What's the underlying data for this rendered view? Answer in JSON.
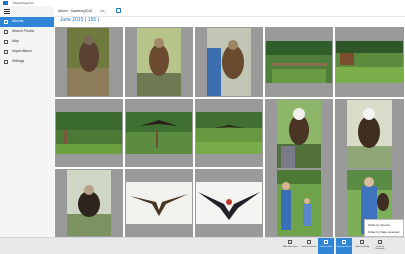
{
  "window": {
    "title": "PhotoOrganizer"
  },
  "sidebar": {
    "items": [
      {
        "label": "Albums",
        "active": true
      },
      {
        "label": "Search Photos",
        "active": false
      },
      {
        "label": "Map",
        "active": false
      },
      {
        "label": "Import Album",
        "active": false
      },
      {
        "label": "Settings",
        "active": false
      }
    ]
  },
  "topbar": {
    "title": "Album - Saarburg2015",
    "count": "(18 )"
  },
  "group": {
    "header": "June 2015 ( 155 )"
  },
  "toolbar": {
    "buttons": [
      {
        "label": "Slide Show Start",
        "active": false
      },
      {
        "label": "Location Remove",
        "active": false
      },
      {
        "label": "Order by Date",
        "active": true
      },
      {
        "label": "Order by Source",
        "active": true
      },
      {
        "label": "Order by Rating",
        "active": false
      },
      {
        "label": "Order by Dimension",
        "active": false
      }
    ]
  },
  "sort_popup": {
    "options": [
      "Order by Source",
      "Order by Date reversed"
    ]
  },
  "colors": {
    "accent": "#2f86d6",
    "tile_bg": "#9a9a9a"
  },
  "photos": [
    "eagle-perched",
    "eagle-perched",
    "eagle-on-glove",
    "zoo-enclosure",
    "zoo-enclosure",
    "trees-fence",
    "bird-in-flight",
    "bird-in-flight",
    "eagle-on-glove",
    "eagle-perched",
    "vulture-on-glove",
    "bird-wings-spread",
    "bird-wings-spread",
    "falconer-with-child",
    "falconer-with-eagle"
  ]
}
